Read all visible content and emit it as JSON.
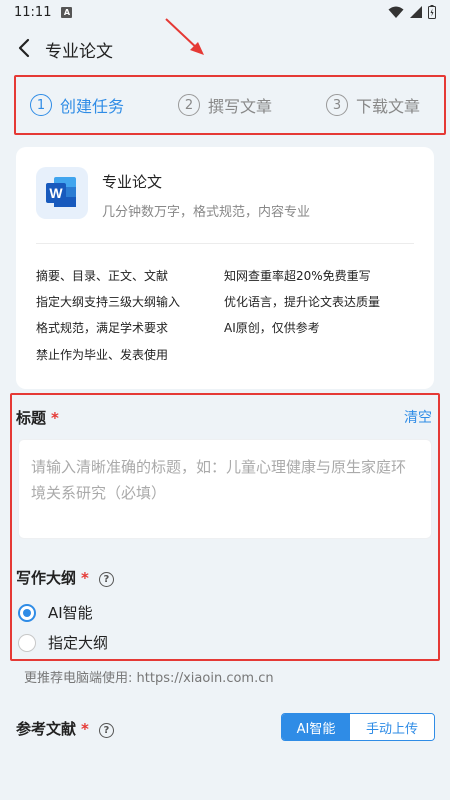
{
  "status_bar": {
    "time": "11:11",
    "notification": "A"
  },
  "header": {
    "title": "专业论文"
  },
  "steps": [
    {
      "num": "1",
      "label": "创建任务",
      "active": true
    },
    {
      "num": "2",
      "label": "撰写文章",
      "active": false
    },
    {
      "num": "3",
      "label": "下载文章",
      "active": false
    }
  ],
  "info_card": {
    "title": "专业论文",
    "subtitle": "几分钟数万字，格式规范，内容专业",
    "icon_letter": "W",
    "features": [
      "摘要、目录、正文、文献",
      "知网查重率超20%免费重写",
      "指定大纲支持三级大纲输入",
      "优化语言，提升论文表达质量",
      "格式规范，满足学术要求",
      "AI原创，仅供参考",
      "禁止作为毕业、发表使用"
    ]
  },
  "form": {
    "title_label": "标题",
    "required_mark": "*",
    "clear_label": "清空",
    "title_placeholder": "请输入清晰准确的标题，如：儿童心理健康与原生家庭环境关系研究（必填）",
    "outline_label": "写作大纲",
    "help_glyph": "?",
    "outline_options": [
      {
        "label": "AI智能",
        "checked": true
      },
      {
        "label": "指定大纲",
        "checked": false
      }
    ]
  },
  "hint": "更推荐电脑端使用: https://xiaoin.com.cn",
  "references": {
    "label": "参考文献",
    "options": [
      "AI智能",
      "手动上传"
    ],
    "selected": "AI智能"
  },
  "colors": {
    "accent": "#2f8ce6",
    "highlight_border": "#e53935",
    "background": "#eef3f7"
  }
}
